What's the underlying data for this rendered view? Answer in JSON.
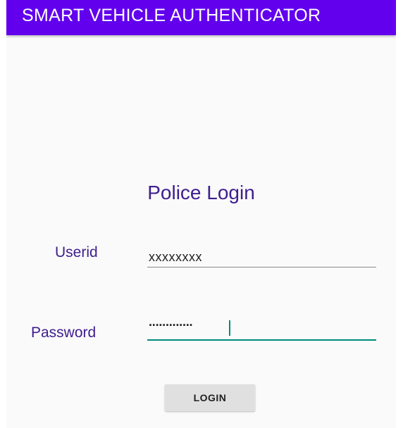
{
  "app_bar": {
    "title": "SMART VEHICLE AUTHENTICATOR",
    "color": "#6200ee"
  },
  "login_form": {
    "heading": "Police Login",
    "userid": {
      "label": "Userid",
      "value": "xxxxxxxx"
    },
    "password": {
      "label": "Password",
      "masked_value": "·············",
      "focused": true
    },
    "login_button_label": "LOGIN"
  },
  "colors": {
    "heading_text": "#3f1d8e",
    "focus_accent": "#00897b",
    "button_bg": "#e0e0e0"
  }
}
